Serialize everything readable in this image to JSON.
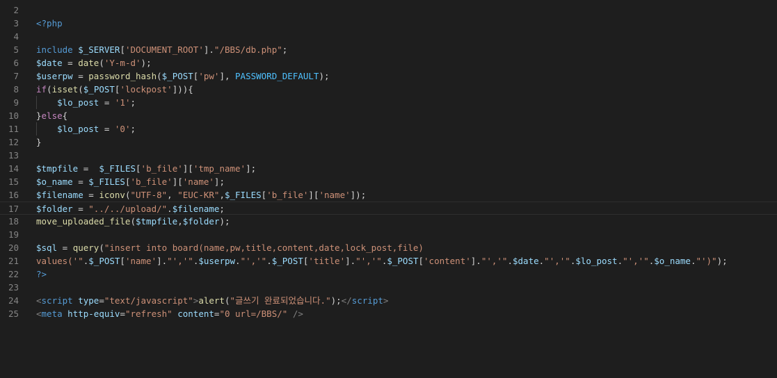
{
  "editor": {
    "active_line": 17,
    "colors": {
      "background": "#1e1e1e",
      "line_number": "#858585",
      "plain": "#d4d4d4",
      "keyword": "#569cd6",
      "control": "#c586c0",
      "string": "#ce9178",
      "variable": "#9cdcfe",
      "function": "#dcdcaa",
      "constant": "#4fc1ff",
      "tag": "#569cd6",
      "attribute": "#9cdcfe",
      "tag_bracket": "#808080"
    },
    "lines": [
      {
        "n": "2",
        "tokens": []
      },
      {
        "n": "3",
        "tokens": [
          [
            "tag",
            "<?php"
          ]
        ]
      },
      {
        "n": "4",
        "tokens": []
      },
      {
        "n": "5",
        "tokens": [
          [
            "keyword",
            "include"
          ],
          [
            "plain",
            " "
          ],
          [
            "variable",
            "$_SERVER"
          ],
          [
            "plain",
            "["
          ],
          [
            "string",
            "'DOCUMENT_ROOT'"
          ],
          [
            "plain",
            "]."
          ],
          [
            "string",
            "\"/BBS/db.php\""
          ],
          [
            "plain",
            ";"
          ]
        ]
      },
      {
        "n": "6",
        "tokens": [
          [
            "variable",
            "$date"
          ],
          [
            "plain",
            " = "
          ],
          [
            "function",
            "date"
          ],
          [
            "plain",
            "("
          ],
          [
            "string",
            "'Y-m-d'"
          ],
          [
            "plain",
            ");"
          ]
        ]
      },
      {
        "n": "7",
        "tokens": [
          [
            "variable",
            "$userpw"
          ],
          [
            "plain",
            " = "
          ],
          [
            "function",
            "password_hash"
          ],
          [
            "plain",
            "("
          ],
          [
            "variable",
            "$_POST"
          ],
          [
            "plain",
            "["
          ],
          [
            "string",
            "'pw'"
          ],
          [
            "plain",
            "], "
          ],
          [
            "constant",
            "PASSWORD_DEFAULT"
          ],
          [
            "plain",
            ");"
          ]
        ]
      },
      {
        "n": "8",
        "tokens": [
          [
            "control",
            "if"
          ],
          [
            "plain",
            "("
          ],
          [
            "function",
            "isset"
          ],
          [
            "plain",
            "("
          ],
          [
            "variable",
            "$_POST"
          ],
          [
            "plain",
            "["
          ],
          [
            "string",
            "'lockpost'"
          ],
          [
            "plain",
            "])){"
          ]
        ]
      },
      {
        "n": "9",
        "guide": true,
        "tokens": [
          [
            "plain",
            "    "
          ],
          [
            "variable",
            "$lo_post"
          ],
          [
            "plain",
            " = "
          ],
          [
            "string",
            "'1'"
          ],
          [
            "plain",
            ";"
          ]
        ]
      },
      {
        "n": "10",
        "tokens": [
          [
            "plain",
            "}"
          ],
          [
            "control",
            "else"
          ],
          [
            "plain",
            "{"
          ]
        ]
      },
      {
        "n": "11",
        "guide": true,
        "tokens": [
          [
            "plain",
            "    "
          ],
          [
            "variable",
            "$lo_post"
          ],
          [
            "plain",
            " = "
          ],
          [
            "string",
            "'0'"
          ],
          [
            "plain",
            ";"
          ]
        ]
      },
      {
        "n": "12",
        "tokens": [
          [
            "plain",
            "}"
          ]
        ]
      },
      {
        "n": "13",
        "tokens": []
      },
      {
        "n": "14",
        "tokens": [
          [
            "variable",
            "$tmpfile"
          ],
          [
            "plain",
            " =  "
          ],
          [
            "variable",
            "$_FILES"
          ],
          [
            "plain",
            "["
          ],
          [
            "string",
            "'b_file'"
          ],
          [
            "plain",
            "]["
          ],
          [
            "string",
            "'tmp_name'"
          ],
          [
            "plain",
            "];"
          ]
        ]
      },
      {
        "n": "15",
        "tokens": [
          [
            "variable",
            "$o_name"
          ],
          [
            "plain",
            " = "
          ],
          [
            "variable",
            "$_FILES"
          ],
          [
            "plain",
            "["
          ],
          [
            "string",
            "'b_file'"
          ],
          [
            "plain",
            "]["
          ],
          [
            "string",
            "'name'"
          ],
          [
            "plain",
            "];"
          ]
        ]
      },
      {
        "n": "16",
        "tokens": [
          [
            "variable",
            "$filename"
          ],
          [
            "plain",
            " = "
          ],
          [
            "function",
            "iconv"
          ],
          [
            "plain",
            "("
          ],
          [
            "string",
            "\"UTF-8\""
          ],
          [
            "plain",
            ", "
          ],
          [
            "string",
            "\"EUC-KR\""
          ],
          [
            "plain",
            ","
          ],
          [
            "variable",
            "$_FILES"
          ],
          [
            "plain",
            "["
          ],
          [
            "string",
            "'b_file'"
          ],
          [
            "plain",
            "]["
          ],
          [
            "string",
            "'name'"
          ],
          [
            "plain",
            "]);"
          ]
        ]
      },
      {
        "n": "17",
        "tokens": [
          [
            "variable",
            "$folder"
          ],
          [
            "plain",
            " = "
          ],
          [
            "string",
            "\"../../upload/\""
          ],
          [
            "plain",
            "."
          ],
          [
            "variable",
            "$filename"
          ],
          [
            "plain",
            ";"
          ]
        ]
      },
      {
        "n": "18",
        "tokens": [
          [
            "function",
            "move_uploaded_file"
          ],
          [
            "plain",
            "("
          ],
          [
            "variable",
            "$tmpfile"
          ],
          [
            "plain",
            ","
          ],
          [
            "variable",
            "$folder"
          ],
          [
            "plain",
            ");"
          ]
        ]
      },
      {
        "n": "19",
        "tokens": []
      },
      {
        "n": "20",
        "tokens": [
          [
            "variable",
            "$sql"
          ],
          [
            "plain",
            " = "
          ],
          [
            "function",
            "query"
          ],
          [
            "plain",
            "("
          ],
          [
            "string",
            "\"insert into board(name,pw,title,content,date,lock_post,file)"
          ]
        ]
      },
      {
        "n": "21",
        "tokens": [
          [
            "string",
            "values('\""
          ],
          [
            "plain",
            "."
          ],
          [
            "variable",
            "$_POST"
          ],
          [
            "plain",
            "["
          ],
          [
            "string",
            "'name'"
          ],
          [
            "plain",
            "]."
          ],
          [
            "string",
            "\"','\""
          ],
          [
            "plain",
            "."
          ],
          [
            "variable",
            "$userpw"
          ],
          [
            "plain",
            "."
          ],
          [
            "string",
            "\"','\""
          ],
          [
            "plain",
            "."
          ],
          [
            "variable",
            "$_POST"
          ],
          [
            "plain",
            "["
          ],
          [
            "string",
            "'title'"
          ],
          [
            "plain",
            "]."
          ],
          [
            "string",
            "\"','\""
          ],
          [
            "plain",
            "."
          ],
          [
            "variable",
            "$_POST"
          ],
          [
            "plain",
            "["
          ],
          [
            "string",
            "'content'"
          ],
          [
            "plain",
            "]."
          ],
          [
            "string",
            "\"','\""
          ],
          [
            "plain",
            "."
          ],
          [
            "variable",
            "$date"
          ],
          [
            "plain",
            "."
          ],
          [
            "string",
            "\"','\""
          ],
          [
            "plain",
            "."
          ],
          [
            "variable",
            "$lo_post"
          ],
          [
            "plain",
            "."
          ],
          [
            "string",
            "\"','\""
          ],
          [
            "plain",
            "."
          ],
          [
            "variable",
            "$o_name"
          ],
          [
            "plain",
            "."
          ],
          [
            "string",
            "\"')\""
          ],
          [
            "plain",
            ");"
          ]
        ]
      },
      {
        "n": "22",
        "tokens": [
          [
            "tag",
            "?>"
          ]
        ]
      },
      {
        "n": "23",
        "tokens": []
      },
      {
        "n": "24",
        "tokens": [
          [
            "tag_bracket",
            "<"
          ],
          [
            "tag",
            "script"
          ],
          [
            "plain",
            " "
          ],
          [
            "attribute",
            "type"
          ],
          [
            "plain",
            "="
          ],
          [
            "string",
            "\"text/javascript\""
          ],
          [
            "tag_bracket",
            ">"
          ],
          [
            "function",
            "alert"
          ],
          [
            "plain",
            "("
          ],
          [
            "string",
            "\"글쓰기 완료되었습니다.\""
          ],
          [
            "plain",
            ");"
          ],
          [
            "tag_bracket",
            "</"
          ],
          [
            "tag",
            "script"
          ],
          [
            "tag_bracket",
            ">"
          ]
        ]
      },
      {
        "n": "25",
        "tokens": [
          [
            "tag_bracket",
            "<"
          ],
          [
            "tag",
            "meta"
          ],
          [
            "plain",
            " "
          ],
          [
            "attribute",
            "http-equiv"
          ],
          [
            "plain",
            "="
          ],
          [
            "string",
            "\"refresh\""
          ],
          [
            "plain",
            " "
          ],
          [
            "attribute",
            "content"
          ],
          [
            "plain",
            "="
          ],
          [
            "string",
            "\"0 url=/BBS/\""
          ],
          [
            "plain",
            " "
          ],
          [
            "tag_bracket",
            "/>"
          ]
        ]
      }
    ]
  }
}
